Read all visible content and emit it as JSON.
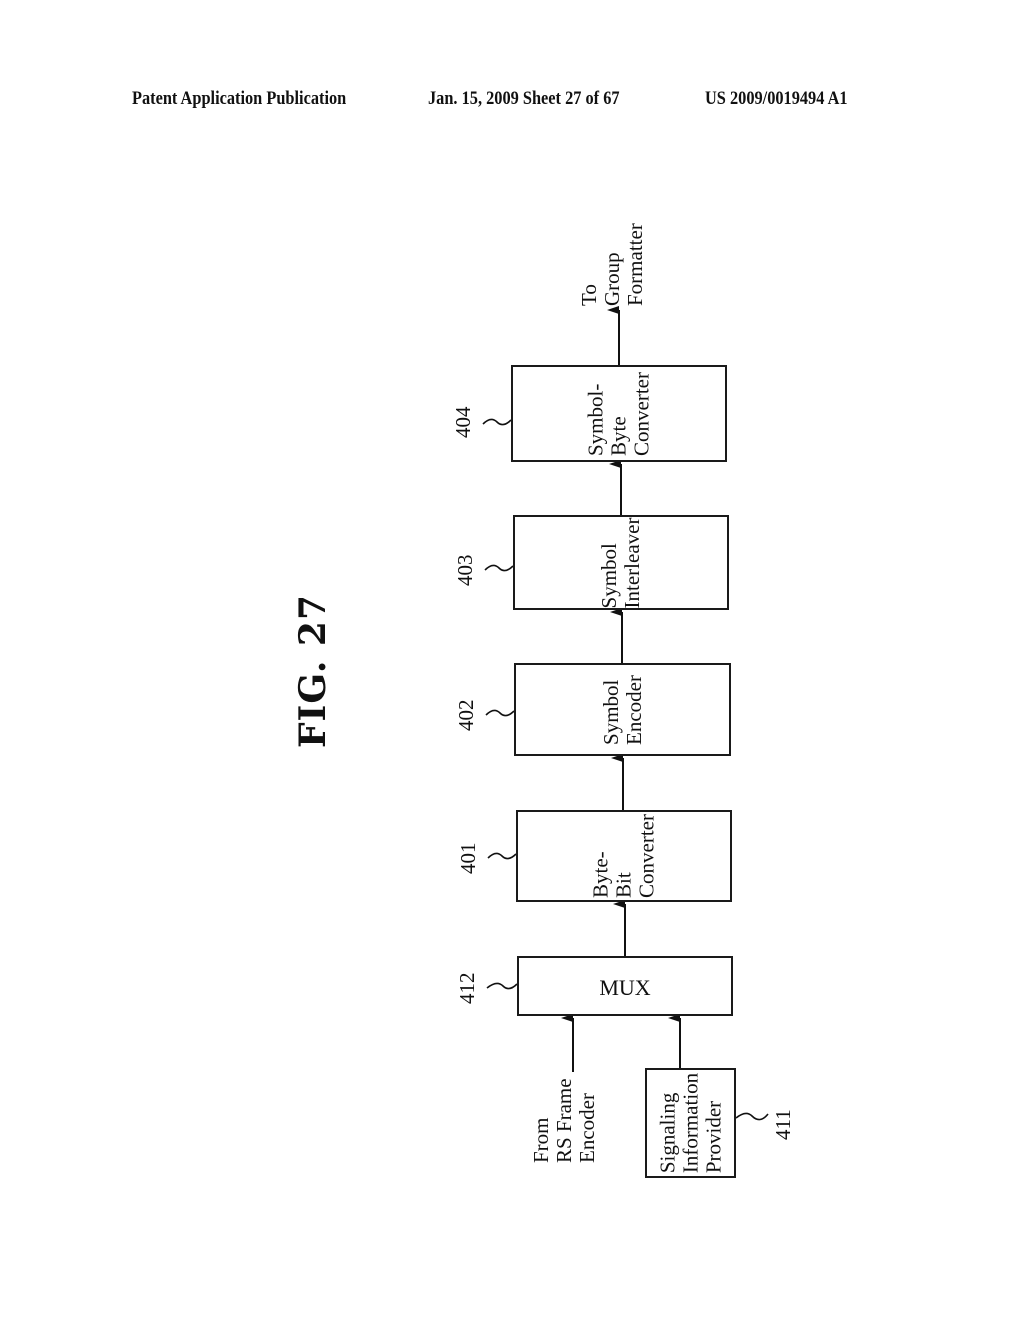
{
  "header": {
    "left": "Patent Application Publication",
    "middle": "Jan. 15, 2009  Sheet 27 of 67",
    "right": "US 2009/0019494 A1"
  },
  "figure": {
    "title": "FIG. 27",
    "blocks": [
      {
        "id": "404",
        "ref": "404",
        "lines": [
          "Symbol-",
          "Byte",
          "Converter"
        ]
      },
      {
        "id": "403",
        "ref": "403",
        "lines": [
          "Symbol",
          "Interleaver"
        ]
      },
      {
        "id": "402",
        "ref": "402",
        "lines": [
          "Symbol",
          "Encoder"
        ]
      },
      {
        "id": "401",
        "ref": "401",
        "lines": [
          "Byte-",
          "Bit",
          "Converter"
        ]
      },
      {
        "id": "412",
        "ref": "412",
        "lines": [
          "MUX"
        ]
      },
      {
        "id": "411",
        "ref": "411",
        "lines": [
          "Signaling",
          "Information",
          "Provider"
        ]
      }
    ],
    "output_label": [
      "To",
      "Group",
      "Formatter"
    ],
    "input_label": [
      "From",
      "RS Frame",
      "Encoder"
    ],
    "connections": [
      [
        "411",
        "412"
      ],
      [
        "input",
        "412"
      ],
      [
        "412",
        "401"
      ],
      [
        "401",
        "402"
      ],
      [
        "402",
        "403"
      ],
      [
        "403",
        "404"
      ],
      [
        "404",
        "output"
      ]
    ]
  }
}
